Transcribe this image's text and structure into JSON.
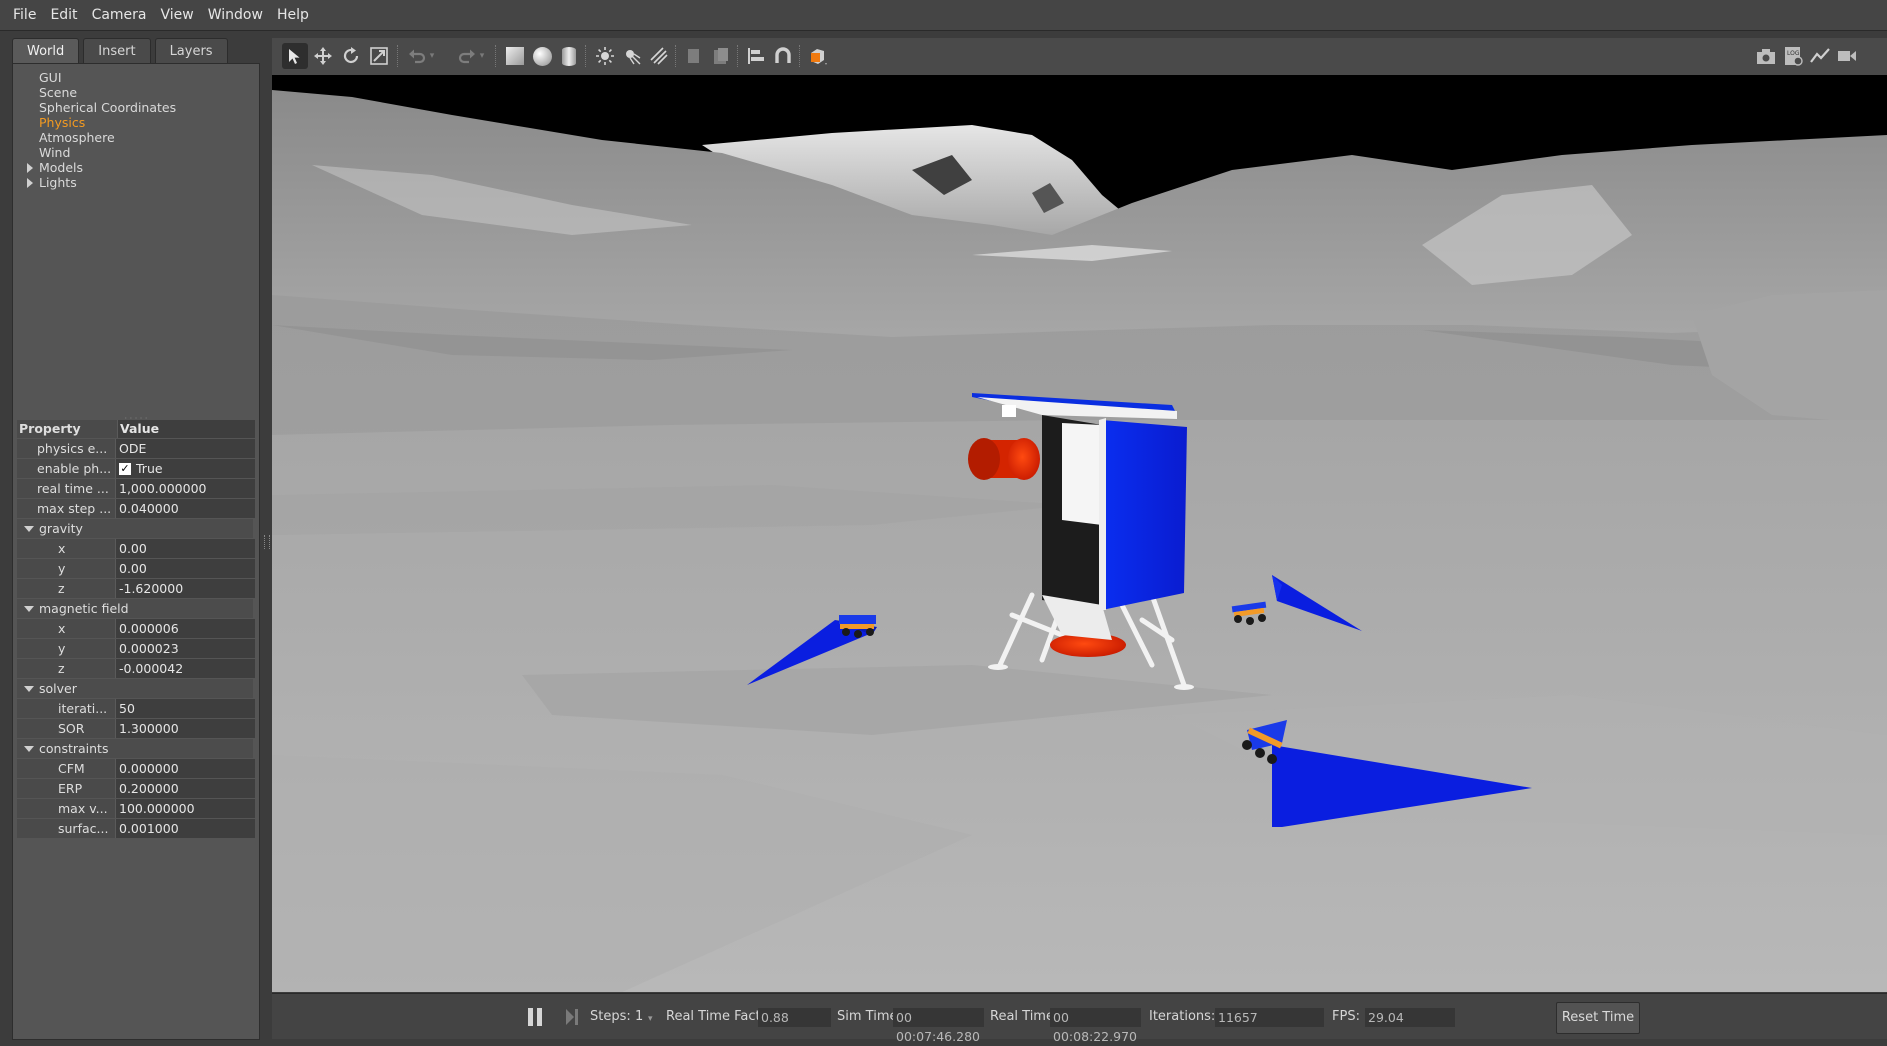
{
  "menu": [
    "File",
    "Edit",
    "Camera",
    "View",
    "Window",
    "Help"
  ],
  "left_panel": {
    "tabs": [
      "World",
      "Insert",
      "Layers"
    ],
    "active_tab": "World",
    "tree": [
      {
        "label": "GUI",
        "expandable": false,
        "selected": false
      },
      {
        "label": "Scene",
        "expandable": false,
        "selected": false
      },
      {
        "label": "Spherical Coordinates",
        "expandable": false,
        "selected": false
      },
      {
        "label": "Physics",
        "expandable": false,
        "selected": true
      },
      {
        "label": "Atmosphere",
        "expandable": false,
        "selected": false
      },
      {
        "label": "Wind",
        "expandable": false,
        "selected": false
      },
      {
        "label": "Models",
        "expandable": true,
        "selected": false
      },
      {
        "label": "Lights",
        "expandable": true,
        "selected": false
      }
    ],
    "property_header": {
      "name": "Property",
      "value": "Value"
    },
    "properties": [
      {
        "kind": "row",
        "name": "physics e...",
        "value": "ODE"
      },
      {
        "kind": "check",
        "name": "enable ph...",
        "value": "True"
      },
      {
        "kind": "row",
        "name": "real time ...",
        "value": "1,000.000000"
      },
      {
        "kind": "row",
        "name": "max step ...",
        "value": "0.040000"
      },
      {
        "kind": "group",
        "name": "gravity"
      },
      {
        "kind": "sub",
        "name": "x",
        "value": "0.00"
      },
      {
        "kind": "sub",
        "name": "y",
        "value": "0.00"
      },
      {
        "kind": "sub",
        "name": "z",
        "value": "-1.620000"
      },
      {
        "kind": "group",
        "name": "magnetic field"
      },
      {
        "kind": "sub",
        "name": "x",
        "value": "0.000006"
      },
      {
        "kind": "sub",
        "name": "y",
        "value": "0.000023"
      },
      {
        "kind": "sub",
        "name": "z",
        "value": "-0.000042"
      },
      {
        "kind": "group",
        "name": "solver"
      },
      {
        "kind": "sub",
        "name": "iterati...",
        "value": "50"
      },
      {
        "kind": "sub",
        "name": "SOR",
        "value": "1.300000"
      },
      {
        "kind": "group",
        "name": "constraints"
      },
      {
        "kind": "sub",
        "name": "CFM",
        "value": "0.000000"
      },
      {
        "kind": "sub",
        "name": "ERP",
        "value": "0.200000"
      },
      {
        "kind": "sub",
        "name": "max v...",
        "value": "100.000000"
      },
      {
        "kind": "sub",
        "name": "surfac...",
        "value": "0.001000"
      }
    ]
  },
  "toolbar": {
    "tools": [
      "select-arrow",
      "translate",
      "rotate",
      "scale",
      "undo",
      "redo",
      "box",
      "sphere",
      "cylinder",
      "point-light",
      "spot-light",
      "directional-light",
      "copy",
      "paste",
      "align",
      "snap",
      "change-view"
    ],
    "right_tools": [
      "screenshot",
      "log",
      "plot",
      "record-video"
    ]
  },
  "status": {
    "steps_label": "Steps:",
    "steps_value": "1",
    "rtf_label": "Real Time Factor:",
    "rtf_value": "0.88",
    "sim_time_label": "Sim Time:",
    "sim_time_value": "00 00:07:46.280",
    "real_time_label": "Real Time:",
    "real_time_value": "00 00:08:22.970",
    "iterations_label": "Iterations:",
    "iterations_value": "11657",
    "fps_label": "FPS:",
    "fps_value": "29.04",
    "reset_label": "Reset Time"
  },
  "colors": {
    "selected_item": "#f39a21",
    "panel_blue": "#0a22e6",
    "engine_red": "#ff2a00",
    "rover_orange": "#f29a28"
  }
}
